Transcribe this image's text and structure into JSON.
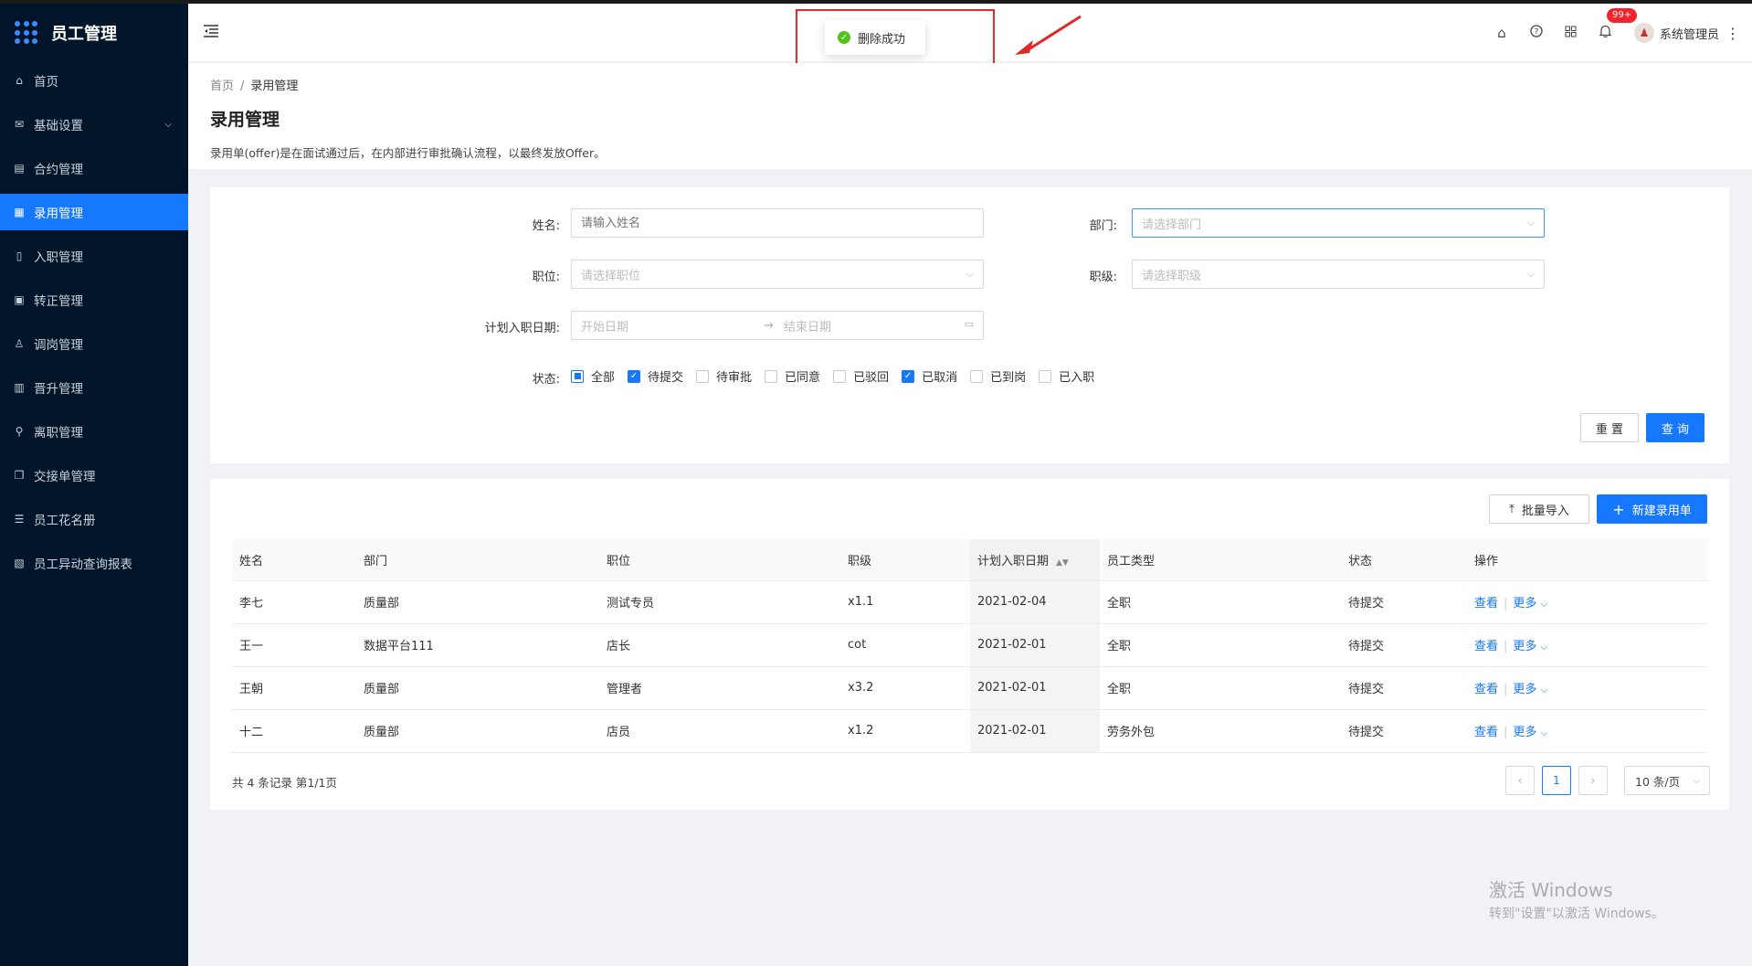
{
  "app": {
    "title": "员工管理"
  },
  "sidebar": {
    "items": [
      {
        "label": "首页",
        "icon": "home-icon",
        "glyph": "⌂"
      },
      {
        "label": "基础设置",
        "icon": "mail-icon",
        "glyph": "✉",
        "has_arrow": true
      },
      {
        "label": "合约管理",
        "icon": "calendar-icon",
        "glyph": "▤"
      },
      {
        "label": "录用管理",
        "icon": "form-icon",
        "glyph": "▦",
        "active": true
      },
      {
        "label": "入职管理",
        "icon": "book-icon",
        "glyph": "▯"
      },
      {
        "label": "转正管理",
        "icon": "grid-icon",
        "glyph": "▣"
      },
      {
        "label": "调岗管理",
        "icon": "user-icon",
        "glyph": "♙"
      },
      {
        "label": "晋升管理",
        "icon": "doc-icon",
        "glyph": "▥"
      },
      {
        "label": "离职管理",
        "icon": "exit-icon",
        "glyph": "⚲"
      },
      {
        "label": "交接单管理",
        "icon": "copy-icon",
        "glyph": "❐"
      },
      {
        "label": "员工花名册",
        "icon": "roster-icon",
        "glyph": "☰"
      },
      {
        "label": "员工异动查询报表",
        "icon": "report-icon",
        "glyph": "▧"
      }
    ]
  },
  "header": {
    "badge": "99+",
    "user_name": "系统管理员"
  },
  "toast": {
    "message": "删除成功"
  },
  "page": {
    "breadcrumb_home": "首页",
    "breadcrumb_sep": "/",
    "breadcrumb_current": "录用管理",
    "title": "录用管理",
    "description": "录用单(offer)是在面试通过后，在内部进行审批确认流程，以最终发放Offer。"
  },
  "filters": {
    "name_label": "姓名:",
    "name_placeholder": "请输入姓名",
    "dept_label": "部门:",
    "dept_placeholder": "请选择部门",
    "position_label": "职位:",
    "position_placeholder": "请选择职位",
    "level_label": "职级:",
    "level_placeholder": "请选择职级",
    "date_label": "计划入职日期:",
    "date_start_placeholder": "开始日期",
    "date_end_placeholder": "结束日期",
    "status_label": "状态:",
    "status_options": [
      {
        "label": "全部",
        "state": "partial"
      },
      {
        "label": "待提交",
        "state": "checked"
      },
      {
        "label": "待审批",
        "state": "unchecked"
      },
      {
        "label": "已同意",
        "state": "unchecked"
      },
      {
        "label": "已驳回",
        "state": "unchecked"
      },
      {
        "label": "已取消",
        "state": "checked"
      },
      {
        "label": "已到岗",
        "state": "unchecked"
      },
      {
        "label": "已入职",
        "state": "unchecked"
      }
    ],
    "reset_label": "重 置",
    "search_label": "查 询"
  },
  "table": {
    "import_label": "批量导入",
    "new_label": "新建录用单",
    "columns": [
      "姓名",
      "部门",
      "职位",
      "职级",
      "计划入职日期",
      "员工类型",
      "状态",
      "操作"
    ],
    "rows": [
      [
        "李七",
        "质量部",
        "测试专员",
        "x1.1",
        "2021-02-04",
        "全职",
        "待提交"
      ],
      [
        "王一",
        "数据平台111",
        "店长",
        "cot",
        "2021-02-01",
        "全职",
        "待提交"
      ],
      [
        "王朝",
        "质量部",
        "管理者",
        "x3.2",
        "2021-02-01",
        "全职",
        "待提交"
      ],
      [
        "十二",
        "质量部",
        "店员",
        "x1.2",
        "2021-02-01",
        "劳务外包",
        "待提交"
      ]
    ],
    "view_label": "查看",
    "more_label": "更多",
    "total_text": "共 4 条记录 第1/1页",
    "current_page": "1",
    "page_size": "10 条/页"
  },
  "watermark": {
    "line1": "激活 Windows",
    "line2": "转到\"设置\"以激活 Windows。"
  },
  "colors": {
    "primary": "#1677ff",
    "sidebar_bg": "#001529",
    "badge": "#f5222d",
    "success": "#52c41a",
    "annotation": "#e02a2a"
  }
}
